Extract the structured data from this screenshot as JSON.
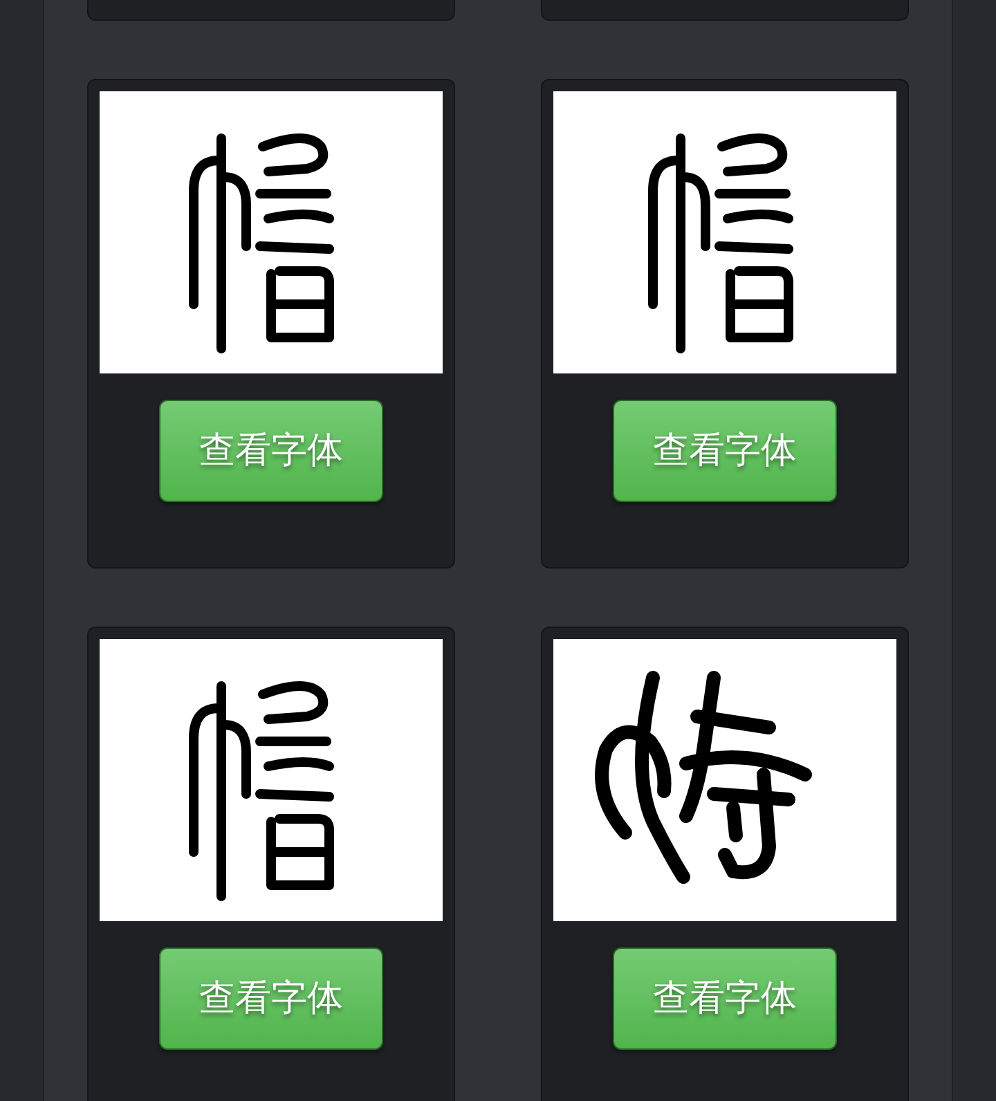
{
  "cards": [
    {
      "kind": "edge"
    },
    {
      "kind": "edge"
    },
    {
      "kind": "sample",
      "button": "查看字体"
    },
    {
      "kind": "sample",
      "button": "查看字体"
    },
    {
      "kind": "sample",
      "button": "查看字体"
    },
    {
      "kind": "sample",
      "button": "查看字体"
    }
  ]
}
